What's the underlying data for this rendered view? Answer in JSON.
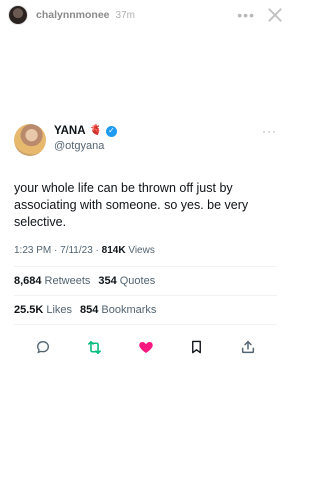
{
  "story": {
    "username": "chalynnmonee",
    "time": "37m"
  },
  "tweet": {
    "name": "YANA",
    "name_emoji": "🫀",
    "verified_mark": "✓",
    "handle": "@otgyana",
    "text_lines": [
      "your whole life can be thrown off just by",
      "associating with someone. so yes. be very",
      "selective."
    ],
    "time": "1:23 PM · 7/11/23 · ",
    "views_count": "814K",
    "views_label": " Views",
    "retweets_count": "8,684",
    "retweets_label": "Retweets",
    "quotes_count": "354",
    "quotes_label": "Quotes",
    "likes_count": "25.5K",
    "likes_label": "Likes",
    "bookmarks_count": "854",
    "bookmarks_label": "Bookmarks"
  },
  "colors": {
    "accent": "#1d9bf0",
    "retweet_green": "#00ba7c",
    "like_pink": "#f91880",
    "text": "#0f1419",
    "secondary": "#536471"
  },
  "icons": [
    "more-icon",
    "close-icon",
    "verified-icon",
    "reply-icon",
    "retweet-icon",
    "like-icon",
    "bookmark-icon",
    "share-icon"
  ]
}
